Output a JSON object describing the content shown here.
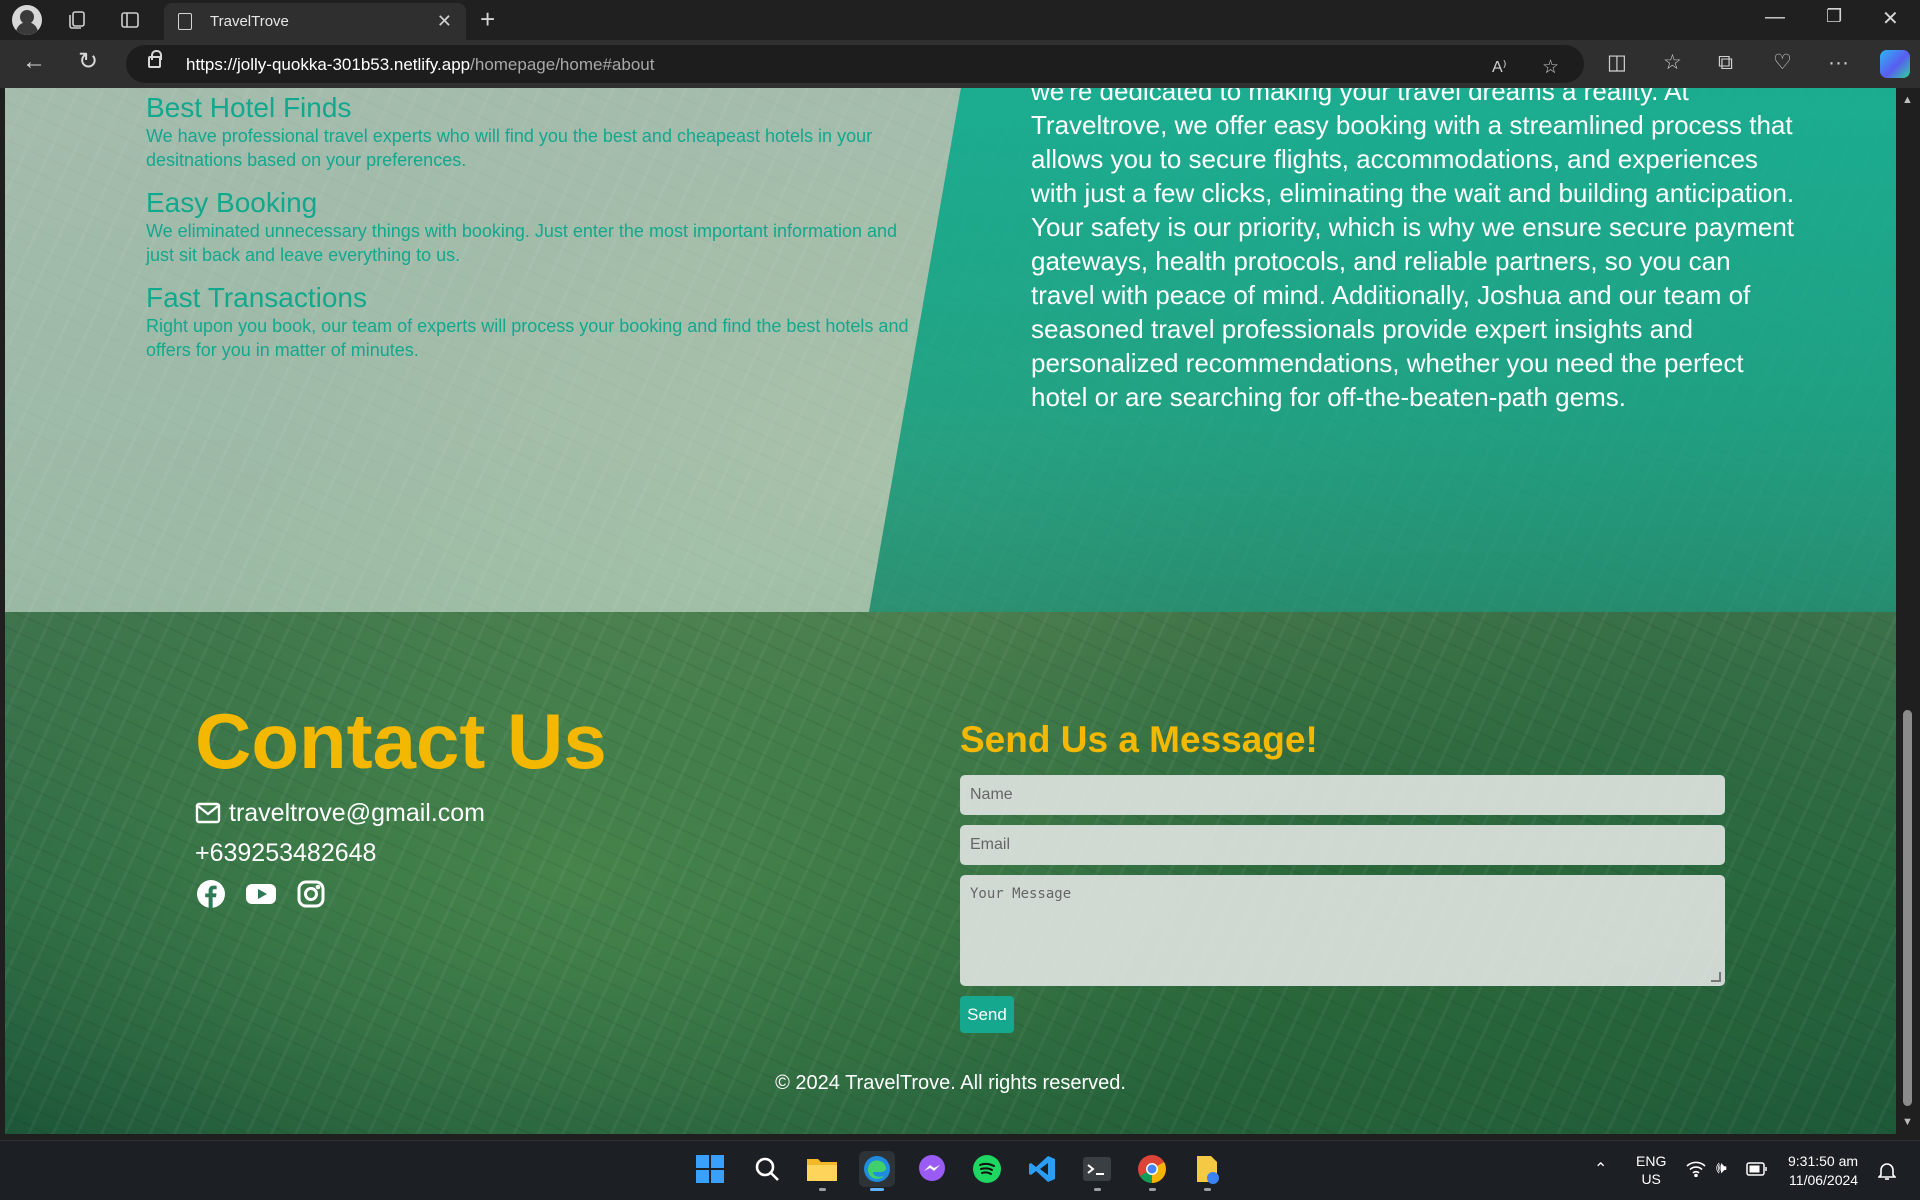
{
  "browser": {
    "tab_title": "TravelTrove",
    "url_host": "https://jolly-quokka-301b53.netlify.app",
    "url_path": "/homepage/home#about"
  },
  "features": [
    {
      "title": "Best Hotel Finds",
      "text": "We have professional travel experts who will find you the best and cheapeast hotels in your desitnations based on your preferences."
    },
    {
      "title": "Easy Booking",
      "text": "We eliminated unnecessary things with booking. Just enter the most important information and just sit back and leave everything to us."
    },
    {
      "title": "Fast Transactions",
      "text": "Right upon you book, our team of experts will process your booking and find the best hotels and offers for you in matter of minutes."
    }
  ],
  "about_text": "we're dedicated to making your travel dreams a reality. At Traveltrove, we offer easy booking with a streamlined process that allows you to secure flights, accommodations, and experiences with just a few clicks, eliminating the wait and building anticipation. Your safety is our priority, which is why we ensure secure payment gateways, health protocols, and reliable partners, so you can travel with peace of mind. Additionally, Joshua and our team of seasoned travel professionals provide expert insights and personalized recommendations, whether you need the perfect hotel or are searching for off-the-beaten-path gems.",
  "contact": {
    "title": "Contact Us",
    "email": "traveltrove@gmail.com",
    "phone": "+639253482648"
  },
  "form": {
    "title": "Send Us a Message!",
    "name_placeholder": "Name",
    "email_placeholder": "Email",
    "message_placeholder": "Your Message",
    "send_label": "Send"
  },
  "footer": "© 2024 TravelTrove. All rights reserved.",
  "taskbar": {
    "lang_top": "ENG",
    "lang_bottom": "US",
    "time": "9:31:50 am",
    "date": "11/06/2024"
  },
  "colors": {
    "accent_teal": "#16a88e",
    "title_gold": "#f5b800"
  }
}
